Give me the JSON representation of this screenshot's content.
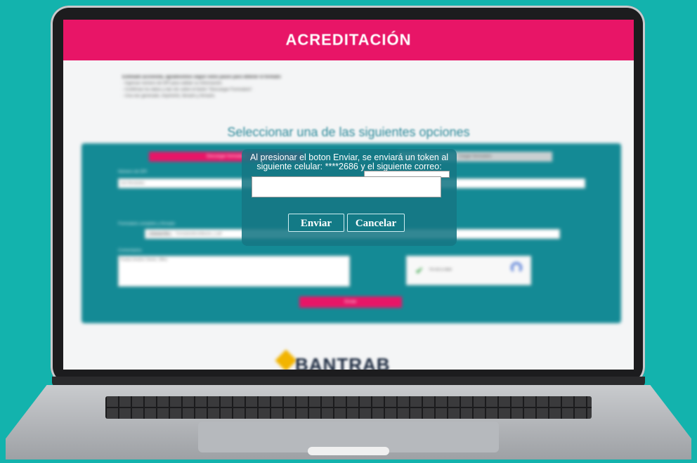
{
  "page": {
    "header_title": "ACREDITACIÓN",
    "instructions": [
      "Estimado accionista, agradecemos seguir estos pasos para obtener el formato:",
      "- Ingresar número de DPI para validar su información.",
      "- Confirmar los datos y dar clic sobre el botón \"Descargar Formulario\".",
      "- Una vez generado, imprimirlo, llenarlo y firmarlo."
    ],
    "select_heading": "Seleccionar una de las siguientes opciones",
    "option_download": "Descargar formulario",
    "option_upload": "Cargar formulario",
    "dpi_label": "Número de DPI",
    "dpi_value": "Ivet Hernández",
    "upload_label": "Formulario completo y firmado",
    "file_button": "Choose File",
    "file_name": "FormularioAcreditacion_1.pdf",
    "comments_label": "Comentarios",
    "comments_value": "Prueba Gestión Cliente, Office",
    "captcha_text": "I'm not a robot",
    "submit_label": "Enviar",
    "footer_brand": "BANTRAB"
  },
  "modal": {
    "message": "Al presionar el boton Enviar, se enviará un token al siguiente celular: ****2686 y el siguiente correo:",
    "send_label": "Enviar",
    "cancel_label": "Cancelar"
  },
  "colors": {
    "background": "#13b3ad",
    "header": "#e81567",
    "panel": "#148a95",
    "modal": "#167684"
  }
}
